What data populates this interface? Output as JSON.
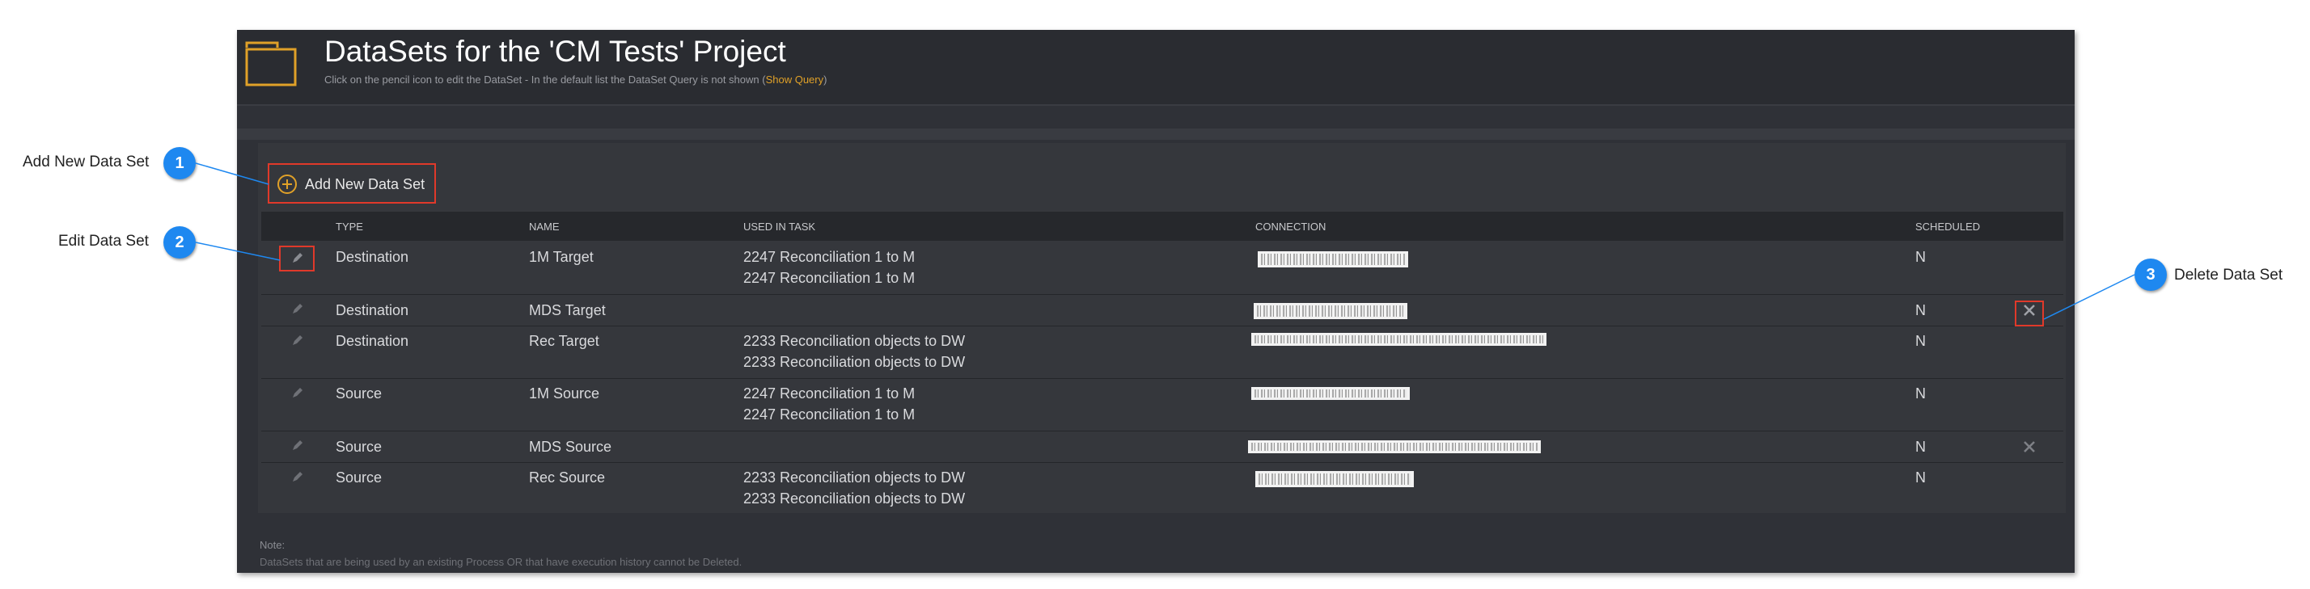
{
  "header": {
    "title": "DataSets for the 'CM Tests' Project",
    "subtitle": "Click on the pencil icon to edit the DataSet - In the default list the DataSet Query is not shown (",
    "show_query": "Show Query",
    "subtitle_end": ")"
  },
  "toolbar": {
    "add_label": "Add New Data Set"
  },
  "table": {
    "columns": [
      "TYPE",
      "NAME",
      "USED IN TASK",
      "CONNECTION",
      "SCHEDULED"
    ],
    "rows": [
      {
        "type": "Destination",
        "name": "1M Target",
        "task1": "2247 Reconciliation 1 to M",
        "task2": "2247 Reconciliation 1 to M",
        "scheduled": "N"
      },
      {
        "type": "Destination",
        "name": "MDS Target",
        "task1": "",
        "task2": "",
        "scheduled": "N"
      },
      {
        "type": "Destination",
        "name": "Rec Target",
        "task1": "2233 Reconciliation objects to DW",
        "task2": "2233 Reconciliation objects to DW",
        "scheduled": "N"
      },
      {
        "type": "Source",
        "name": "1M Source",
        "task1": "2247 Reconciliation 1 to M",
        "task2": "2247 Reconciliation 1 to M",
        "scheduled": "N"
      },
      {
        "type": "Source",
        "name": "MDS Source",
        "task1": "",
        "task2": "",
        "scheduled": "N"
      },
      {
        "type": "Source",
        "name": "Rec Source",
        "task1": "2233 Reconciliation objects to DW",
        "task2": "2233 Reconciliation objects to DW",
        "scheduled": "N"
      }
    ]
  },
  "note": {
    "label": "Note:",
    "text": "DataSets that are being used by an existing Process OR that have execution history cannot be Deleted."
  },
  "callouts": [
    {
      "number": "1",
      "label": "Add New Data Set"
    },
    {
      "number": "2",
      "label": "Edit Data Set"
    },
    {
      "number": "3",
      "label": "Delete Data Set"
    }
  ],
  "colors": {
    "accent": "#e0a128",
    "highlight": "#e0392a",
    "badge": "#1e88f0",
    "panel": "#2f3137"
  }
}
